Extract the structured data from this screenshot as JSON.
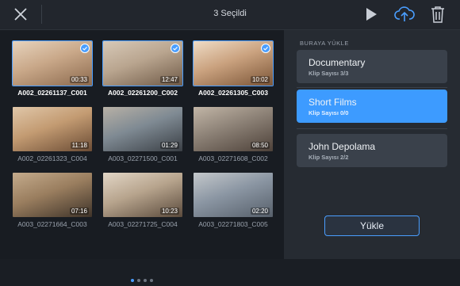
{
  "header": {
    "title": "3 Seçildi",
    "icons": [
      "close-icon",
      "play-icon",
      "cloud-upload-icon",
      "trash-icon"
    ],
    "accent": "#4a9eff"
  },
  "clips": [
    {
      "name": "A002_02261137_C001",
      "duration": "00:33",
      "selected": true
    },
    {
      "name": "A002_02261200_C002",
      "duration": "12:47",
      "selected": true
    },
    {
      "name": "A002_02261305_C003",
      "duration": "10:02",
      "selected": true
    },
    {
      "name": "A002_02261323_C004",
      "duration": "11:18",
      "selected": false
    },
    {
      "name": "A003_02271500_C001",
      "duration": "01:29",
      "selected": false
    },
    {
      "name": "A003_02271608_C002",
      "duration": "08:50",
      "selected": false
    },
    {
      "name": "A003_02271664_C003",
      "duration": "07:16",
      "selected": false
    },
    {
      "name": "A003_02271725_C004",
      "duration": "10:23",
      "selected": false
    },
    {
      "name": "A003_02271803_C005",
      "duration": "02:20",
      "selected": false
    }
  ],
  "pagination": {
    "pages": 4,
    "current": 1
  },
  "destinations": {
    "section_label": "BURAYA YÜKLE",
    "items": [
      {
        "name": "Documentary",
        "sub": "Klip Sayısı 3/3",
        "active": false
      },
      {
        "name": "Short Films",
        "sub": "Klip Sayısı 0/0",
        "active": true
      },
      {
        "name": "John Depolama",
        "sub": "Klip Sayısı 2/2",
        "active": false
      }
    ]
  },
  "upload_button": "Yükle"
}
